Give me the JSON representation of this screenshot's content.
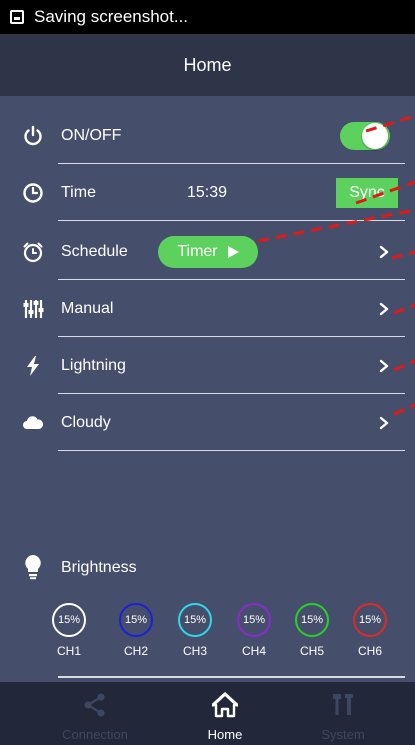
{
  "statusbar": {
    "text": "Saving screenshot..."
  },
  "header": {
    "title": "Home"
  },
  "rows": {
    "onoff": {
      "label": "ON/OFF",
      "toggle_on": true
    },
    "time": {
      "label": "Time",
      "value": "15:39",
      "sync_label": "Sync"
    },
    "schedule": {
      "label": "Schedule",
      "timer_label": "Timer"
    },
    "manual": {
      "label": "Manual"
    },
    "lightning": {
      "label": "Lightning"
    },
    "cloudy": {
      "label": "Cloudy"
    }
  },
  "brightness": {
    "label": "Brightness",
    "channels": [
      {
        "name": "CH1",
        "value": "15%",
        "color": "#ffffff"
      },
      {
        "name": "CH2",
        "value": "15%",
        "color": "#1f1fd8"
      },
      {
        "name": "CH3",
        "value": "15%",
        "color": "#2fd8e8"
      },
      {
        "name": "CH4",
        "value": "15%",
        "color": "#8a2ad0"
      },
      {
        "name": "CH5",
        "value": "15%",
        "color": "#2ad02a"
      },
      {
        "name": "CH6",
        "value": "15%",
        "color": "#e02a2a"
      }
    ]
  },
  "nav": {
    "connection": "Connection",
    "home": "Home",
    "system": "System",
    "active": "home"
  },
  "colors": {
    "accent_green": "#5cd15e",
    "background": "#454e6a",
    "header": "#2f3548",
    "navbar": "#22283a",
    "annotation_red": "#e01818"
  }
}
